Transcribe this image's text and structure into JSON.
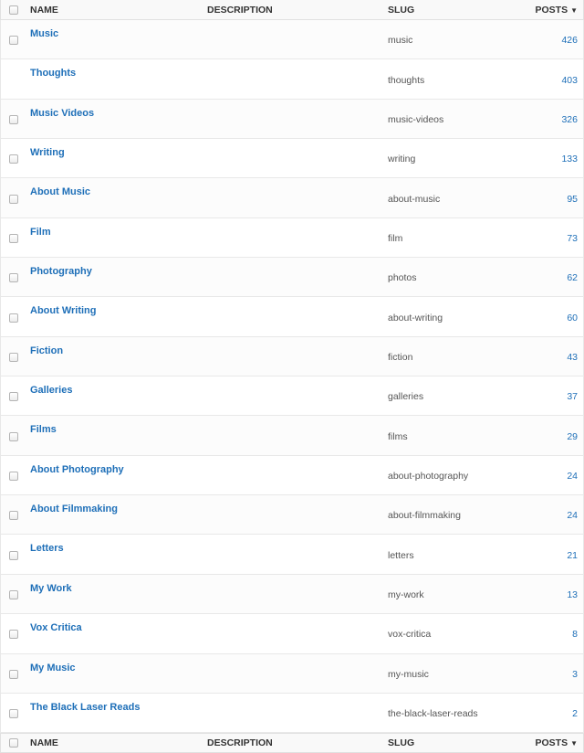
{
  "columns": {
    "name": "Name",
    "description": "Description",
    "slug": "Slug",
    "posts": "Posts",
    "sort_icon": "triangle-down"
  },
  "categories": [
    {
      "name": "Music",
      "slug": "music",
      "posts": "426",
      "has_checkbox": true
    },
    {
      "name": "Thoughts",
      "slug": "thoughts",
      "posts": "403",
      "has_checkbox": false
    },
    {
      "name": "Music Videos",
      "slug": "music-videos",
      "posts": "326",
      "has_checkbox": true
    },
    {
      "name": "Writing",
      "slug": "writing",
      "posts": "133",
      "has_checkbox": true
    },
    {
      "name": "About Music",
      "slug": "about-music",
      "posts": "95",
      "has_checkbox": true
    },
    {
      "name": "Film",
      "slug": "film",
      "posts": "73",
      "has_checkbox": true
    },
    {
      "name": "Photography",
      "slug": "photos",
      "posts": "62",
      "has_checkbox": true
    },
    {
      "name": "About Writing",
      "slug": "about-writing",
      "posts": "60",
      "has_checkbox": true
    },
    {
      "name": "Fiction",
      "slug": "fiction",
      "posts": "43",
      "has_checkbox": true
    },
    {
      "name": "Galleries",
      "slug": "galleries",
      "posts": "37",
      "has_checkbox": true
    },
    {
      "name": "Films",
      "slug": "films",
      "posts": "29",
      "has_checkbox": true
    },
    {
      "name": "About Photography",
      "slug": "about-photography",
      "posts": "24",
      "has_checkbox": true
    },
    {
      "name": "About Filmmaking",
      "slug": "about-filmmaking",
      "posts": "24",
      "has_checkbox": true
    },
    {
      "name": "Letters",
      "slug": "letters",
      "posts": "21",
      "has_checkbox": true
    },
    {
      "name": "My Work",
      "slug": "my-work",
      "posts": "13",
      "has_checkbox": true
    },
    {
      "name": "Vox Critica",
      "slug": "vox-critica",
      "posts": "8",
      "has_checkbox": true
    },
    {
      "name": "My Music",
      "slug": "my-music",
      "posts": "3",
      "has_checkbox": true
    },
    {
      "name": "The Black Laser Reads",
      "slug": "the-black-laser-reads",
      "posts": "2",
      "has_checkbox": true
    }
  ],
  "colors": {
    "link": "#1e6fb8",
    "header_bg": "#f9f9f9",
    "border": "#e1e1e1"
  }
}
